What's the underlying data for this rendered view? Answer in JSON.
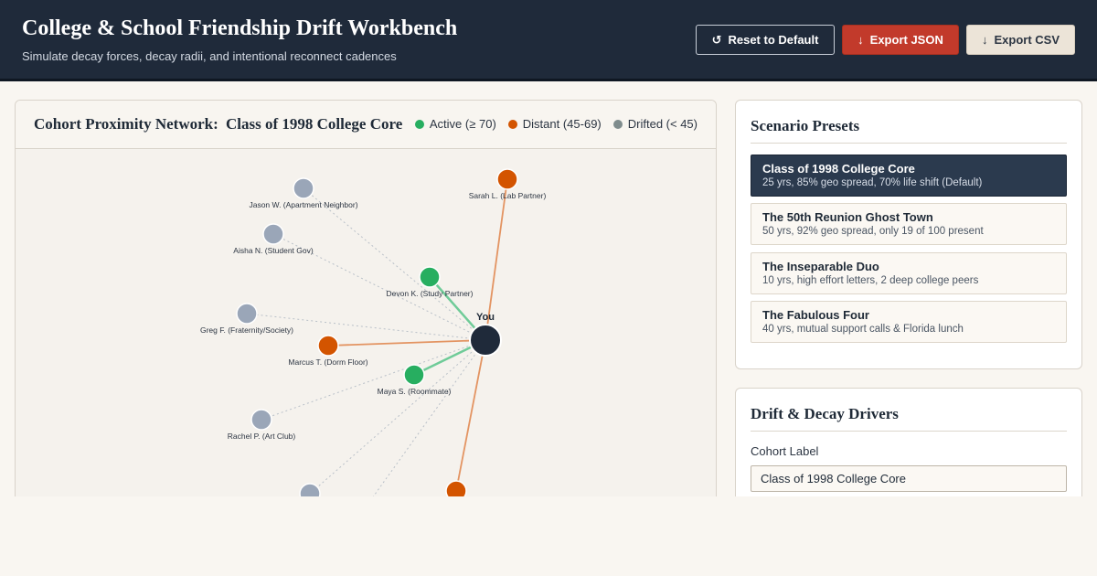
{
  "header": {
    "title": "College & School Friendship Drift Workbench",
    "subtitle": "Simulate decay forces, decay radii, and intentional reconnect cadences",
    "buttons": {
      "reset": {
        "icon": "reset-icon",
        "glyph": "↺",
        "label": "Reset to Default"
      },
      "export_json": {
        "icon": "download-icon",
        "glyph": "↓",
        "label": "Export JSON"
      },
      "export_csv": {
        "icon": "download-icon",
        "glyph": "↓",
        "label": "Export CSV"
      }
    }
  },
  "network": {
    "title_prefix": "Cohort Proximity Network:",
    "cohort_name": "Class of 1998 College Core",
    "legend": [
      {
        "label": "Active (≥ 70)",
        "color": "#27ae60"
      },
      {
        "label": "Distant (45-69)",
        "color": "#d35400"
      },
      {
        "label": "Drifted (< 45)",
        "color": "#7f8c8d"
      }
    ],
    "center": {
      "label": "You",
      "color": "#1f2a3a"
    },
    "friends": [
      {
        "label": "Jason W. (Apartment Neighbor)",
        "status": "drifted"
      },
      {
        "label": "Sarah L. (Lab Partner)",
        "status": "distant"
      },
      {
        "label": "Aisha N. (Student Gov)",
        "status": "drifted"
      },
      {
        "label": "Devon K. (Study Partner)",
        "status": "active"
      },
      {
        "label": "Greg F. (Fraternity/Society)",
        "status": "drifted"
      },
      {
        "label": "Marcus T. (Dorm Floor)",
        "status": "distant"
      },
      {
        "label": "Maya S. (Roommate)",
        "status": "active"
      },
      {
        "label": "Rachel P. (Art Club)",
        "status": "drifted"
      },
      {
        "label": "",
        "status": "drifted"
      },
      {
        "label": "",
        "status": "distant"
      }
    ],
    "colors": {
      "active": "#27ae60",
      "distant": "#d35400",
      "drifted": "#9aa6b8",
      "drifted_line": "#b9c0c8",
      "active_line": "#6fcb98",
      "distant_line": "#e39462"
    }
  },
  "presets": {
    "title": "Scenario Presets",
    "items": [
      {
        "name": "Class of 1998 College Core",
        "desc": "25 yrs, 85% geo spread, 70% life shift (Default)",
        "active": true
      },
      {
        "name": "The 50th Reunion Ghost Town",
        "desc": "50 yrs, 92% geo spread, only 19 of 100 present",
        "active": false
      },
      {
        "name": "The Inseparable Duo",
        "desc": "10 yrs, high effort letters, 2 deep college peers",
        "active": false
      },
      {
        "name": "The Fabulous Four",
        "desc": "40 yrs, mutual support calls & Florida lunch",
        "active": false
      }
    ]
  },
  "drivers": {
    "title": "Drift & Decay Drivers",
    "cohort_label": "Cohort Label",
    "cohort_value": "Class of 1998 College Core"
  }
}
